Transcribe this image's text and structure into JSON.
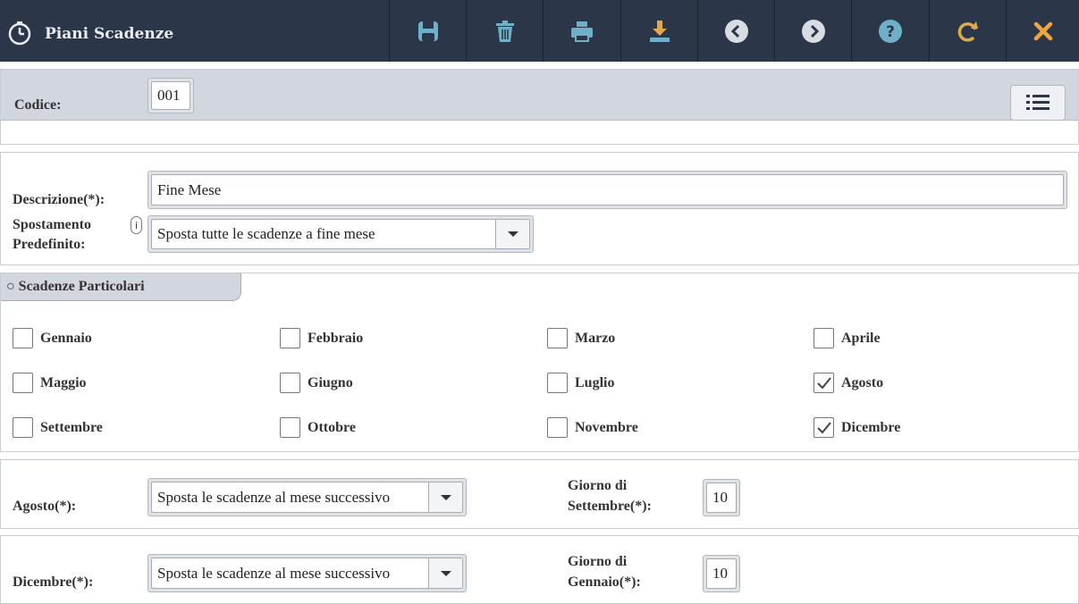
{
  "header": {
    "title": "Piani Scadenze",
    "app_icon": "stopwatch-icon",
    "buttons": [
      {
        "name": "save-button",
        "icon": "floppy-icon",
        "color": "#6fb0c8"
      },
      {
        "name": "delete-button",
        "icon": "trash-icon",
        "color": "#6fb0c8"
      },
      {
        "name": "print-button",
        "icon": "printer-icon",
        "color": "#6fb0c8"
      },
      {
        "name": "download-button",
        "icon": "download-icon",
        "color": "#e0a94a"
      },
      {
        "name": "previous-button",
        "icon": "chevron-left-circle-icon",
        "color": "#d9dde3"
      },
      {
        "name": "next-button",
        "icon": "chevron-right-circle-icon",
        "color": "#d9dde3"
      },
      {
        "name": "help-button",
        "icon": "help-circle-icon",
        "color": "#6fb0c8"
      },
      {
        "name": "refresh-button",
        "icon": "redo-icon",
        "color": "#e0a94a"
      },
      {
        "name": "close-button",
        "icon": "close-icon",
        "color": "#f0a63c"
      }
    ]
  },
  "codice": {
    "label": "Codice:",
    "value": "001",
    "list_icon": "list-icon"
  },
  "main": {
    "descrizione_label": "Descrizione(*):",
    "descrizione_value": "Fine Mese",
    "spostamento_label_1": "Spostamento",
    "spostamento_label_2": "Predefinito:",
    "info_badge": "i",
    "spostamento_value": "Sposta tutte le scadenze a fine mese"
  },
  "scadenze": {
    "title": "○ Scadenze Particolari",
    "months": [
      {
        "label": "Gennaio",
        "checked": false
      },
      {
        "label": "Febbraio",
        "checked": false
      },
      {
        "label": "Marzo",
        "checked": false
      },
      {
        "label": "Aprile",
        "checked": false
      },
      {
        "label": "Maggio",
        "checked": false
      },
      {
        "label": "Giugno",
        "checked": false
      },
      {
        "label": "Luglio",
        "checked": false
      },
      {
        "label": "Agosto",
        "checked": true
      },
      {
        "label": "Settembre",
        "checked": false
      },
      {
        "label": "Ottobre",
        "checked": false
      },
      {
        "label": "Novembre",
        "checked": false
      },
      {
        "label": "Dicembre",
        "checked": true
      }
    ]
  },
  "agosto": {
    "label": "Agosto(*):",
    "value": "Sposta le scadenze al mese successivo",
    "giorno_label_1": "Giorno di",
    "giorno_label_2": "Settembre(*):",
    "giorno_value": "10"
  },
  "dicembre": {
    "label": "Dicembre(*):",
    "value": "Sposta le scadenze al mese successivo",
    "giorno_label_1": "Giorno di",
    "giorno_label_2": "Gennaio(*):",
    "giorno_value": "10"
  }
}
